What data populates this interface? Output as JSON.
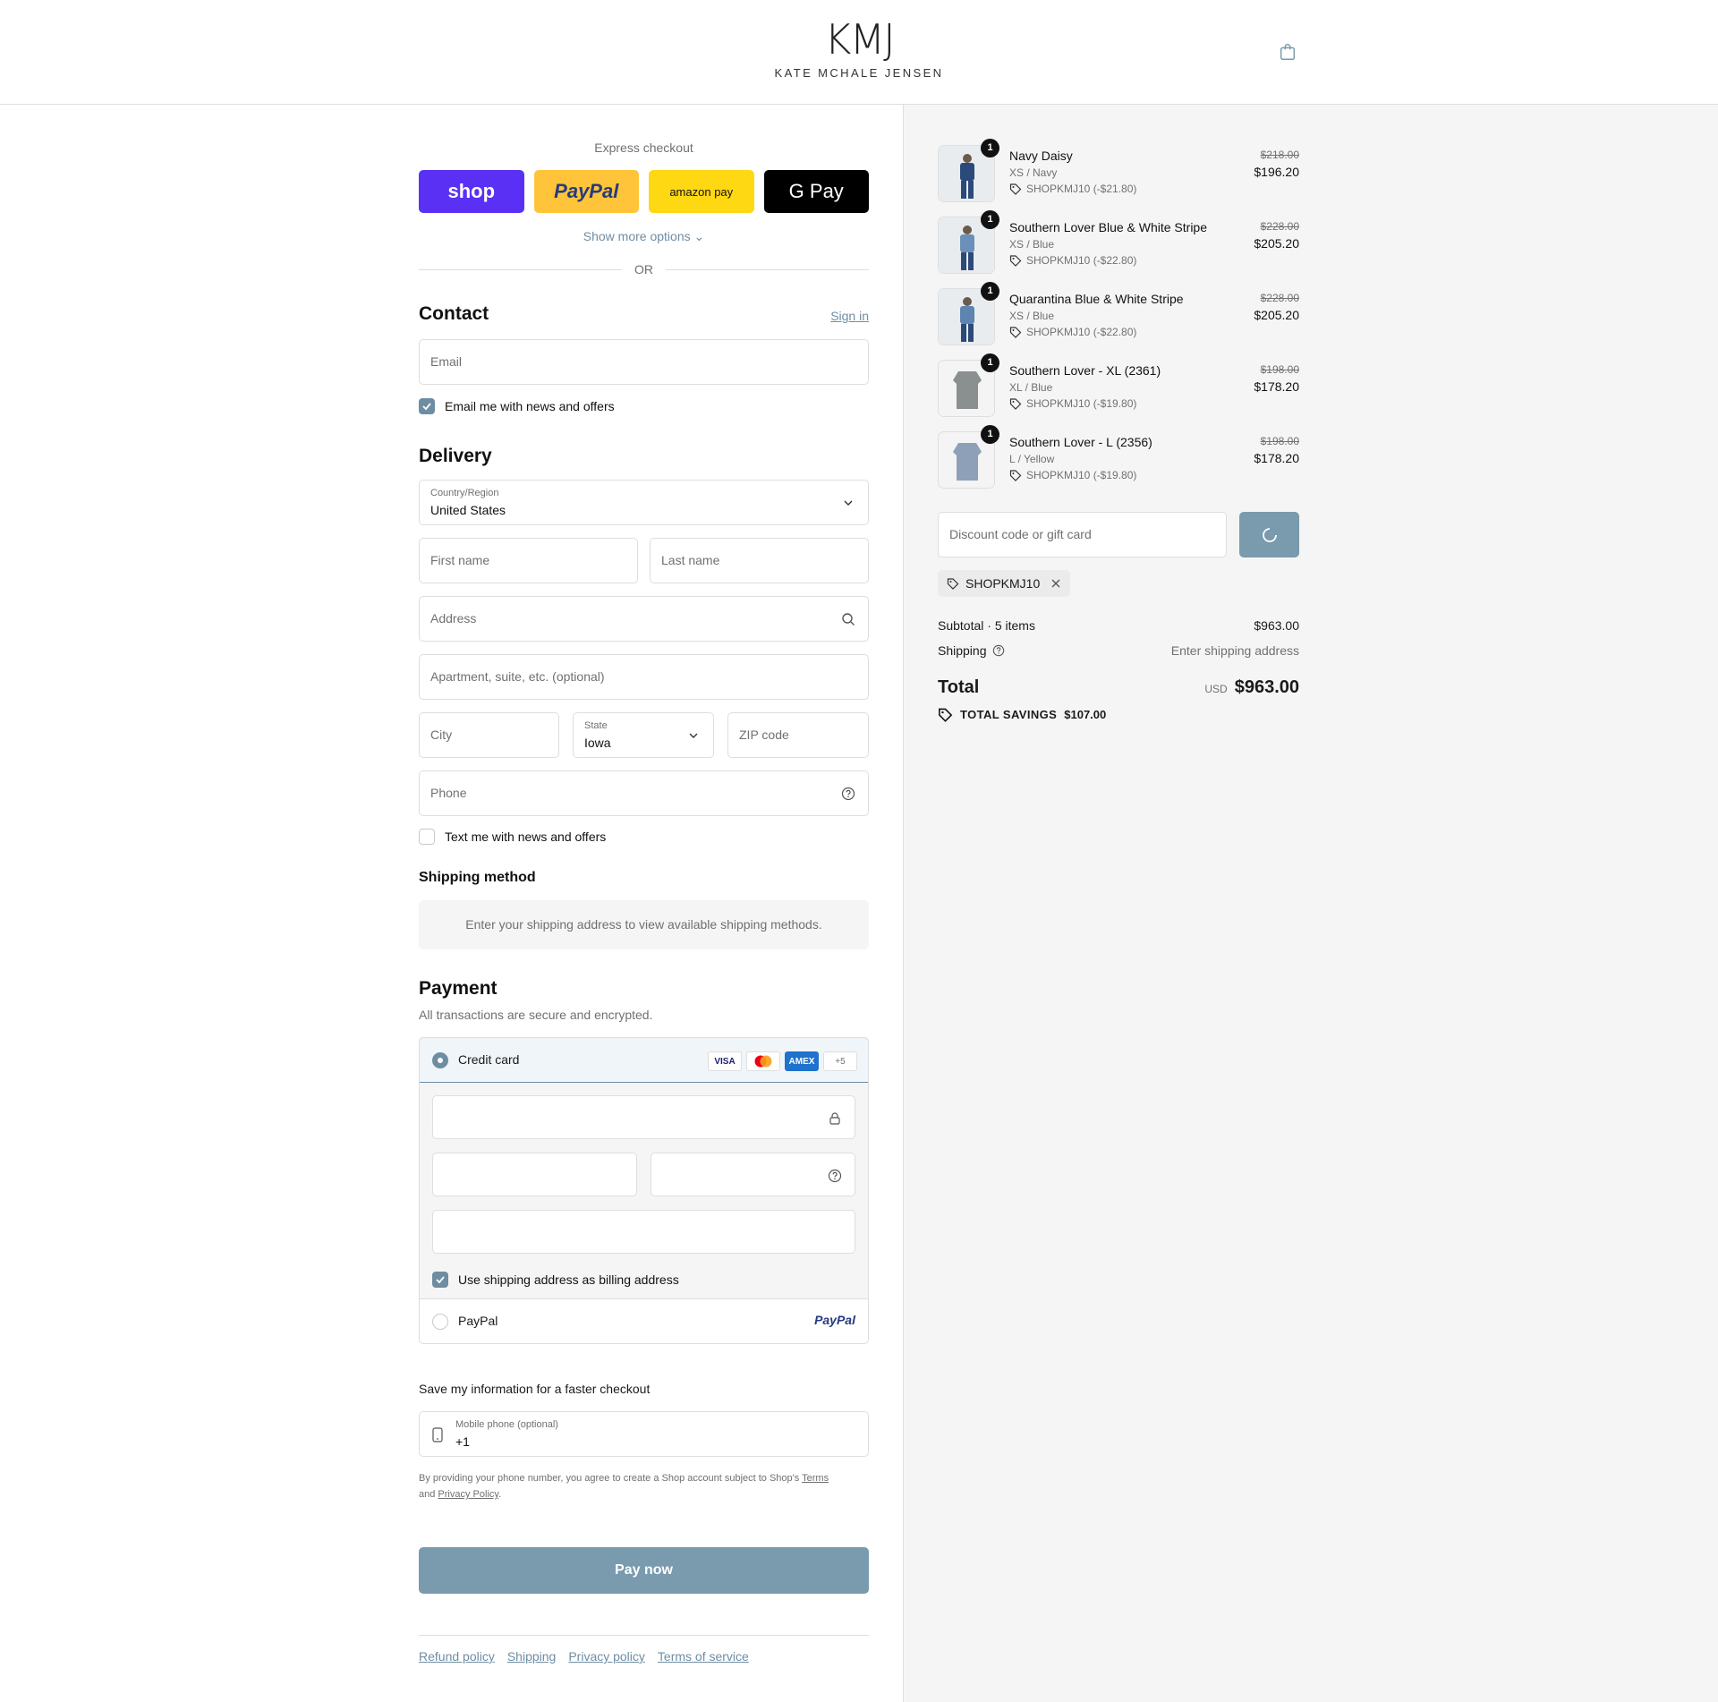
{
  "header": {
    "logo_mark": "KMJ",
    "logo_text": "KATE MCHALE JENSEN"
  },
  "express": {
    "title": "Express checkout",
    "shop_label": "shop",
    "paypal_label": "PayPal",
    "amazon_label": "amazon pay",
    "gpay_label": "G Pay",
    "more_options": "Show more options",
    "or": "OR"
  },
  "contact": {
    "title": "Contact",
    "sign_in": "Sign in",
    "email_placeholder": "Email",
    "news_label": "Email me with news and offers"
  },
  "delivery": {
    "title": "Delivery",
    "country_label": "Country/Region",
    "country_value": "United States",
    "first_name": "First name",
    "last_name": "Last name",
    "address": "Address",
    "apartment": "Apartment, suite, etc. (optional)",
    "city": "City",
    "state_label": "State",
    "state_value": "Iowa",
    "zip": "ZIP code",
    "phone": "Phone",
    "text_news": "Text me with news and offers"
  },
  "shipping_method": {
    "title": "Shipping method",
    "notice": "Enter your shipping address to view available shipping methods."
  },
  "payment": {
    "title": "Payment",
    "subtitle": "All transactions are secure and encrypted.",
    "credit_card": "Credit card",
    "card_logos": [
      "VISA",
      "MC",
      "AMEX",
      "+5"
    ],
    "billing_same": "Use shipping address as billing address",
    "paypal": "PayPal",
    "paypal_logo": "PayPal"
  },
  "save_info": {
    "title": "Save my information for a faster checkout",
    "mobile_label": "Mobile phone (optional)",
    "mobile_value": "+1",
    "legal_1": "By providing your phone number, you agree to create a Shop account subject to Shop's ",
    "terms": "Terms",
    "legal_and": "and ",
    "privacy": "Privacy Policy",
    "legal_end": "."
  },
  "pay_now": "Pay now",
  "footer_links": [
    "Refund policy",
    "Shipping",
    "Privacy policy",
    "Terms of service"
  ],
  "items": [
    {
      "qty": "1",
      "name": "Navy Daisy",
      "variant": "XS / Navy",
      "discount": "SHOPKMJ10 (-$21.80)",
      "original": "$218.00",
      "price": "$196.20",
      "color": "#2a4a7a"
    },
    {
      "qty": "1",
      "name": "Southern Lover Blue & White Stripe",
      "variant": "XS / Blue",
      "discount": "SHOPKMJ10 (-$22.80)",
      "original": "$228.00",
      "price": "$205.20",
      "color": "#6b8fb8"
    },
    {
      "qty": "1",
      "name": "Quarantina Blue & White Stripe",
      "variant": "XS / Blue",
      "discount": "SHOPKMJ10 (-$22.80)",
      "original": "$228.00",
      "price": "$205.20",
      "color": "#5e84b0"
    },
    {
      "qty": "1",
      "name": "Southern Lover - XL (2361)",
      "variant": "XL / Blue",
      "discount": "SHOPKMJ10 (-$19.80)",
      "original": "$198.00",
      "price": "$178.20",
      "color": "#8a9090"
    },
    {
      "qty": "1",
      "name": "Southern Lover - L (2356)",
      "variant": "L / Yellow",
      "discount": "SHOPKMJ10 (-$19.80)",
      "original": "$198.00",
      "price": "$178.20",
      "color": "#8ea0b8"
    }
  ],
  "discount": {
    "placeholder": "Discount code or gift card",
    "applied_code": "SHOPKMJ10"
  },
  "summary": {
    "subtotal_label": "Subtotal · 5 items",
    "subtotal_value": "$963.00",
    "shipping_label": "Shipping",
    "shipping_value": "Enter shipping address",
    "total_label": "Total",
    "currency": "USD",
    "total_value": "$963.00",
    "savings_label": "TOTAL SAVINGS",
    "savings_value": "$107.00"
  },
  "colors": {
    "accent": "#6e8da3",
    "button": "#7a9aad",
    "shop_purple": "#5a31f4",
    "paypal_yellow": "#ffc439",
    "amazon_yellow": "#ffd814"
  }
}
